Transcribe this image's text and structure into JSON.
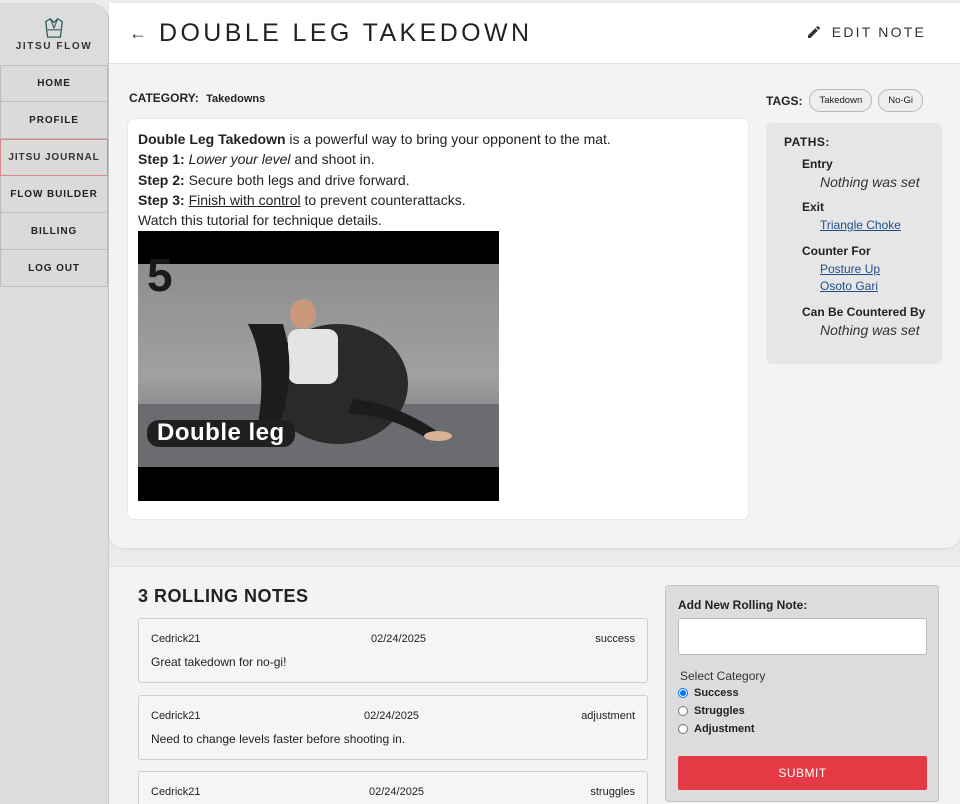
{
  "app": {
    "logo_text": "JITSU FLOW",
    "accent": "#e63946"
  },
  "sidebar": {
    "items": [
      {
        "label": "HOME"
      },
      {
        "label": "PROFILE"
      },
      {
        "label": "JITSU JOURNAL",
        "active": true
      },
      {
        "label": "FLOW BUILDER"
      },
      {
        "label": "BILLING"
      },
      {
        "label": "LOG OUT"
      }
    ]
  },
  "header": {
    "title": "DOUBLE LEG TAKEDOWN",
    "edit_label": "EDIT NOTE"
  },
  "technique": {
    "category_label": "CATEGORY:",
    "category_value": "Takedowns",
    "intro_bold": "Double Leg Takedown",
    "intro_rest": " is a powerful way to bring your opponent to the mat.",
    "step1_label": "Step 1:",
    "step1_em": "Lower your level",
    "step1_rest": " and shoot in.",
    "step2_label": "Step 2:",
    "step2_text": " Secure both legs and drive forward.",
    "step3_label": "Step 3:",
    "step3_u": "Finish with control",
    "step3_rest": " to prevent counterattacks.",
    "video_note": "Watch this tutorial for technique details.",
    "video_number": "5",
    "video_caption": "Double leg"
  },
  "tags": {
    "label": "TAGS:",
    "items": [
      "Takedown",
      "No-Gi"
    ]
  },
  "paths": {
    "title": "PATHS:",
    "entry_label": "Entry",
    "entry_empty": "Nothing was set",
    "exit_label": "Exit",
    "exit_links": [
      "Triangle Choke"
    ],
    "counter_for_label": "Counter For",
    "counter_for_links": [
      "Posture Up",
      "Osoto Gari"
    ],
    "countered_by_label": "Can Be Countered By",
    "countered_by_empty": "Nothing was set"
  },
  "rolling_notes": {
    "title": "3 ROLLING NOTES",
    "notes": [
      {
        "author": "Cedrick21",
        "date": "02/24/2025",
        "status": "success",
        "text": "Great takedown for no-gi!"
      },
      {
        "author": "Cedrick21",
        "date": "02/24/2025",
        "status": "adjustment",
        "text": "Need to change levels faster before shooting in."
      },
      {
        "author": "Cedrick21",
        "date": "02/24/2025",
        "status": "struggles",
        "text": ""
      }
    ]
  },
  "add_note": {
    "title": "Add New Rolling Note:",
    "textarea_value": "",
    "select_category_label": "Select Category",
    "options": [
      "Success",
      "Struggles",
      "Adjustment"
    ],
    "selected": "Success",
    "submit_label": "SUBMIT"
  }
}
